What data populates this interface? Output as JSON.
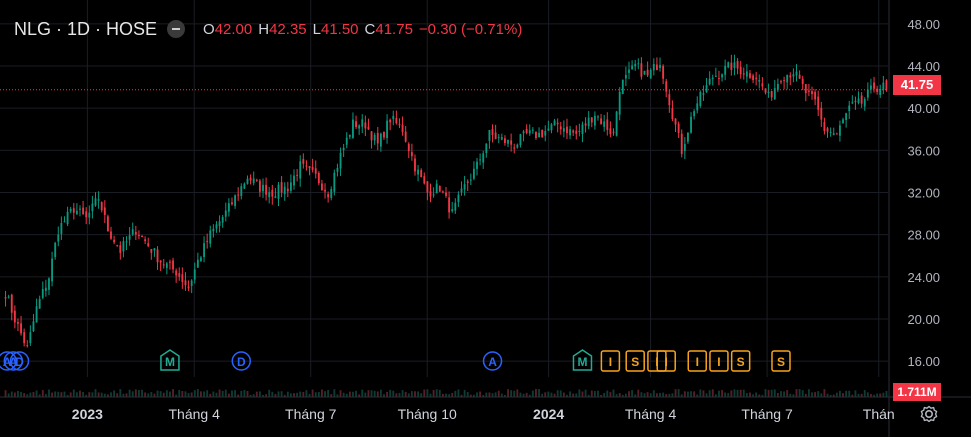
{
  "header": {
    "symbol": "NLG · 1D · HOSE",
    "o_label": "O",
    "o_value": "42.00",
    "h_label": "H",
    "h_value": "42.35",
    "l_label": "L",
    "l_value": "41.50",
    "c_label": "C",
    "c_value": "41.75",
    "change": "−0.30 (−0.71%)"
  },
  "price_tag": "41.75",
  "volume_tag": "1.711M",
  "colors": {
    "up": "#089981",
    "down": "#f23645",
    "bg": "#000000",
    "grid": "#1a1d24",
    "event_blue": "#2962ff",
    "event_green": "#22ab94",
    "event_orange": "#f7a21b"
  },
  "chart_data": {
    "type": "candlestick",
    "y_axis": {
      "ticks": [
        "48.00",
        "44.00",
        "40.00",
        "36.00",
        "32.00",
        "28.00",
        "24.00",
        "20.00",
        "16.00"
      ],
      "ylim": [
        14.5,
        49.5
      ],
      "scale": "linear",
      "position": "right"
    },
    "x_axis": {
      "labels": [
        "2023",
        "Tháng 4",
        "Tháng 7",
        "Tháng 10",
        "2024",
        "Tháng 4",
        "Tháng 7",
        "Thán"
      ]
    },
    "grid": true,
    "last_price": 41.75,
    "close_anchors": [
      [
        0,
        22.5
      ],
      [
        3,
        20
      ],
      [
        7,
        17.2
      ],
      [
        10,
        21
      ],
      [
        14,
        24
      ],
      [
        17,
        28.5
      ],
      [
        22,
        30.5
      ],
      [
        26,
        29.5
      ],
      [
        30,
        31.5
      ],
      [
        33,
        28.5
      ],
      [
        37,
        26.5
      ],
      [
        42,
        28.5
      ],
      [
        46,
        27
      ],
      [
        50,
        25.5
      ],
      [
        55,
        24.5
      ],
      [
        59,
        23
      ],
      [
        62,
        25.5
      ],
      [
        66,
        28
      ],
      [
        72,
        30.5
      ],
      [
        78,
        33.5
      ],
      [
        82,
        32.5
      ],
      [
        86,
        32
      ],
      [
        91,
        32.5
      ],
      [
        95,
        34.5
      ],
      [
        100,
        33.5
      ],
      [
        104,
        32
      ],
      [
        108,
        35.5
      ],
      [
        112,
        38.5
      ],
      [
        116,
        38.5
      ],
      [
        120,
        36.5
      ],
      [
        124,
        39
      ],
      [
        128,
        38
      ],
      [
        132,
        34.5
      ],
      [
        136,
        32
      ],
      [
        140,
        32.5
      ],
      [
        144,
        30
      ],
      [
        148,
        32.5
      ],
      [
        152,
        34.5
      ],
      [
        156,
        37.5
      ],
      [
        160,
        37
      ],
      [
        164,
        36.5
      ],
      [
        168,
        37.5
      ],
      [
        172,
        37.5
      ],
      [
        178,
        38.5
      ],
      [
        184,
        37.5
      ],
      [
        190,
        39.5
      ],
      [
        196,
        37.5
      ],
      [
        198,
        42
      ],
      [
        203,
        44
      ],
      [
        207,
        43
      ],
      [
        211,
        44.5
      ],
      [
        215,
        39.5
      ],
      [
        218,
        36
      ],
      [
        222,
        40
      ],
      [
        228,
        43
      ],
      [
        234,
        44
      ],
      [
        238,
        43.5
      ],
      [
        242,
        43
      ],
      [
        246,
        41
      ],
      [
        250,
        43
      ],
      [
        254,
        43.5
      ],
      [
        258,
        41.5
      ],
      [
        261,
        40.5
      ],
      [
        264,
        38
      ],
      [
        268,
        37.5
      ],
      [
        272,
        40
      ],
      [
        276,
        40.5
      ],
      [
        280,
        42
      ],
      [
        284,
        42
      ]
    ],
    "events": [
      {
        "letter": "A",
        "x": 0.5,
        "color": "blue"
      },
      {
        "letter": "A",
        "x": 2.5,
        "color": "blue"
      },
      {
        "letter": "D",
        "x": 4.5,
        "color": "blue"
      },
      {
        "letter": "M",
        "x": 53,
        "color": "green"
      },
      {
        "letter": "D",
        "x": 76,
        "color": "blue"
      },
      {
        "letter": "A",
        "x": 157,
        "color": "blue"
      },
      {
        "letter": "M",
        "x": 186,
        "color": "green"
      },
      {
        "letter": "I",
        "x": 195,
        "color": "orange"
      },
      {
        "letter": "S",
        "x": 203,
        "color": "orange"
      },
      {
        "letter": "I",
        "x": 210,
        "color": "orange"
      },
      {
        "letter": "I",
        "x": 213,
        "color": "orange"
      },
      {
        "letter": "I",
        "x": 223,
        "color": "orange"
      },
      {
        "letter": "I",
        "x": 230,
        "color": "orange"
      },
      {
        "letter": "S",
        "x": 237,
        "color": "orange"
      },
      {
        "letter": "S",
        "x": 250,
        "color": "orange"
      }
    ]
  }
}
